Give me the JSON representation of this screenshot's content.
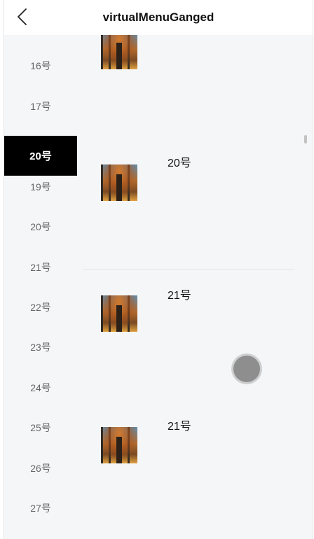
{
  "header": {
    "title": "virtualMenuGanged",
    "back_icon": "chevron-left-icon"
  },
  "sidebar": {
    "items": [
      {
        "label": "16号",
        "active": false
      },
      {
        "label": "17号",
        "active": false
      },
      {
        "label": "20号",
        "active": true
      },
      {
        "label": "19号",
        "active": false
      },
      {
        "label": "20号",
        "active": false
      },
      {
        "label": "21号",
        "active": false
      },
      {
        "label": "22号",
        "active": false
      },
      {
        "label": "23号",
        "active": false
      },
      {
        "label": "24号",
        "active": false
      },
      {
        "label": "25号",
        "active": false
      },
      {
        "label": "26号",
        "active": false
      },
      {
        "label": "27号",
        "active": false
      }
    ]
  },
  "content": {
    "items": [
      {
        "label": ""
      },
      {
        "label": "20号"
      },
      {
        "label": "21号"
      },
      {
        "label": "21号"
      }
    ]
  },
  "colors": {
    "active_bg": "#000000",
    "active_text": "#ffffff",
    "inactive_text": "#666666",
    "page_bg": "#f5f6f7"
  }
}
